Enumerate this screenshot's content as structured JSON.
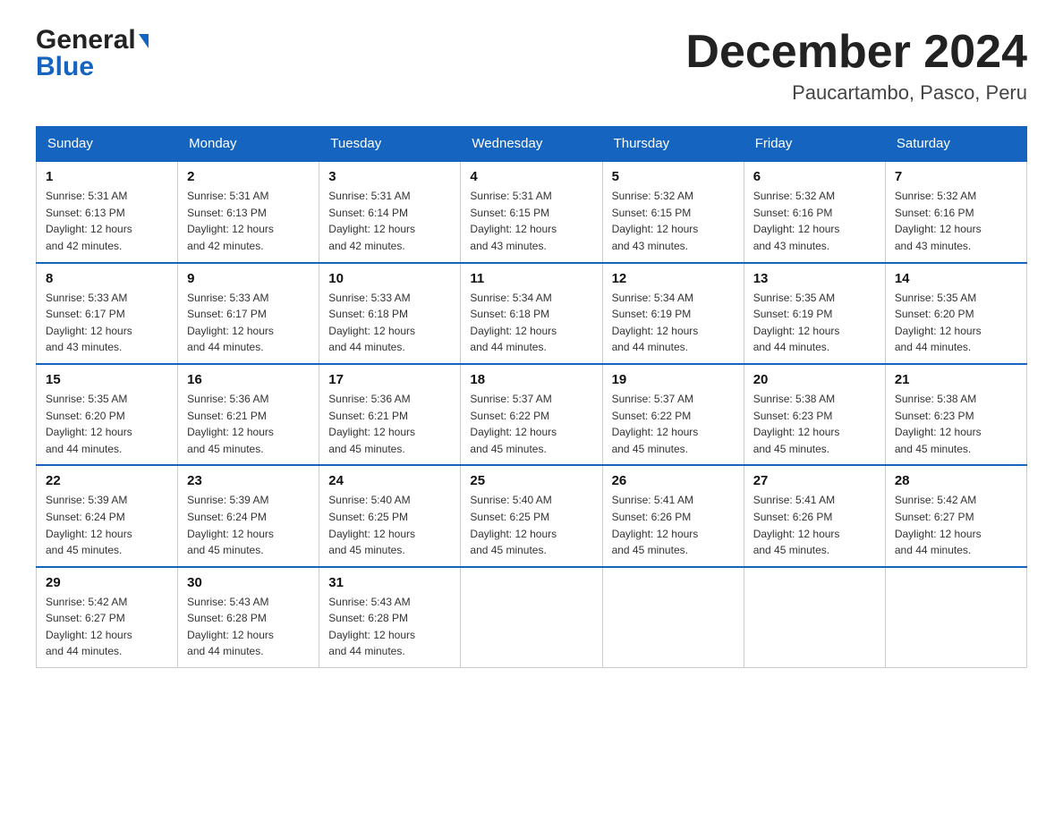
{
  "logo": {
    "general": "General",
    "blue": "Blue"
  },
  "header": {
    "month_year": "December 2024",
    "location": "Paucartambo, Pasco, Peru"
  },
  "days_of_week": [
    "Sunday",
    "Monday",
    "Tuesday",
    "Wednesday",
    "Thursday",
    "Friday",
    "Saturday"
  ],
  "weeks": [
    [
      {
        "day": "1",
        "sunrise": "5:31 AM",
        "sunset": "6:13 PM",
        "daylight": "12 hours and 42 minutes."
      },
      {
        "day": "2",
        "sunrise": "5:31 AM",
        "sunset": "6:13 PM",
        "daylight": "12 hours and 42 minutes."
      },
      {
        "day": "3",
        "sunrise": "5:31 AM",
        "sunset": "6:14 PM",
        "daylight": "12 hours and 42 minutes."
      },
      {
        "day": "4",
        "sunrise": "5:31 AM",
        "sunset": "6:15 PM",
        "daylight": "12 hours and 43 minutes."
      },
      {
        "day": "5",
        "sunrise": "5:32 AM",
        "sunset": "6:15 PM",
        "daylight": "12 hours and 43 minutes."
      },
      {
        "day": "6",
        "sunrise": "5:32 AM",
        "sunset": "6:16 PM",
        "daylight": "12 hours and 43 minutes."
      },
      {
        "day": "7",
        "sunrise": "5:32 AM",
        "sunset": "6:16 PM",
        "daylight": "12 hours and 43 minutes."
      }
    ],
    [
      {
        "day": "8",
        "sunrise": "5:33 AM",
        "sunset": "6:17 PM",
        "daylight": "12 hours and 43 minutes."
      },
      {
        "day": "9",
        "sunrise": "5:33 AM",
        "sunset": "6:17 PM",
        "daylight": "12 hours and 44 minutes."
      },
      {
        "day": "10",
        "sunrise": "5:33 AM",
        "sunset": "6:18 PM",
        "daylight": "12 hours and 44 minutes."
      },
      {
        "day": "11",
        "sunrise": "5:34 AM",
        "sunset": "6:18 PM",
        "daylight": "12 hours and 44 minutes."
      },
      {
        "day": "12",
        "sunrise": "5:34 AM",
        "sunset": "6:19 PM",
        "daylight": "12 hours and 44 minutes."
      },
      {
        "day": "13",
        "sunrise": "5:35 AM",
        "sunset": "6:19 PM",
        "daylight": "12 hours and 44 minutes."
      },
      {
        "day": "14",
        "sunrise": "5:35 AM",
        "sunset": "6:20 PM",
        "daylight": "12 hours and 44 minutes."
      }
    ],
    [
      {
        "day": "15",
        "sunrise": "5:35 AM",
        "sunset": "6:20 PM",
        "daylight": "12 hours and 44 minutes."
      },
      {
        "day": "16",
        "sunrise": "5:36 AM",
        "sunset": "6:21 PM",
        "daylight": "12 hours and 45 minutes."
      },
      {
        "day": "17",
        "sunrise": "5:36 AM",
        "sunset": "6:21 PM",
        "daylight": "12 hours and 45 minutes."
      },
      {
        "day": "18",
        "sunrise": "5:37 AM",
        "sunset": "6:22 PM",
        "daylight": "12 hours and 45 minutes."
      },
      {
        "day": "19",
        "sunrise": "5:37 AM",
        "sunset": "6:22 PM",
        "daylight": "12 hours and 45 minutes."
      },
      {
        "day": "20",
        "sunrise": "5:38 AM",
        "sunset": "6:23 PM",
        "daylight": "12 hours and 45 minutes."
      },
      {
        "day": "21",
        "sunrise": "5:38 AM",
        "sunset": "6:23 PM",
        "daylight": "12 hours and 45 minutes."
      }
    ],
    [
      {
        "day": "22",
        "sunrise": "5:39 AM",
        "sunset": "6:24 PM",
        "daylight": "12 hours and 45 minutes."
      },
      {
        "day": "23",
        "sunrise": "5:39 AM",
        "sunset": "6:24 PM",
        "daylight": "12 hours and 45 minutes."
      },
      {
        "day": "24",
        "sunrise": "5:40 AM",
        "sunset": "6:25 PM",
        "daylight": "12 hours and 45 minutes."
      },
      {
        "day": "25",
        "sunrise": "5:40 AM",
        "sunset": "6:25 PM",
        "daylight": "12 hours and 45 minutes."
      },
      {
        "day": "26",
        "sunrise": "5:41 AM",
        "sunset": "6:26 PM",
        "daylight": "12 hours and 45 minutes."
      },
      {
        "day": "27",
        "sunrise": "5:41 AM",
        "sunset": "6:26 PM",
        "daylight": "12 hours and 45 minutes."
      },
      {
        "day": "28",
        "sunrise": "5:42 AM",
        "sunset": "6:27 PM",
        "daylight": "12 hours and 44 minutes."
      }
    ],
    [
      {
        "day": "29",
        "sunrise": "5:42 AM",
        "sunset": "6:27 PM",
        "daylight": "12 hours and 44 minutes."
      },
      {
        "day": "30",
        "sunrise": "5:43 AM",
        "sunset": "6:28 PM",
        "daylight": "12 hours and 44 minutes."
      },
      {
        "day": "31",
        "sunrise": "5:43 AM",
        "sunset": "6:28 PM",
        "daylight": "12 hours and 44 minutes."
      },
      null,
      null,
      null,
      null
    ]
  ],
  "labels": {
    "sunrise": "Sunrise:",
    "sunset": "Sunset:",
    "daylight": "Daylight:"
  }
}
